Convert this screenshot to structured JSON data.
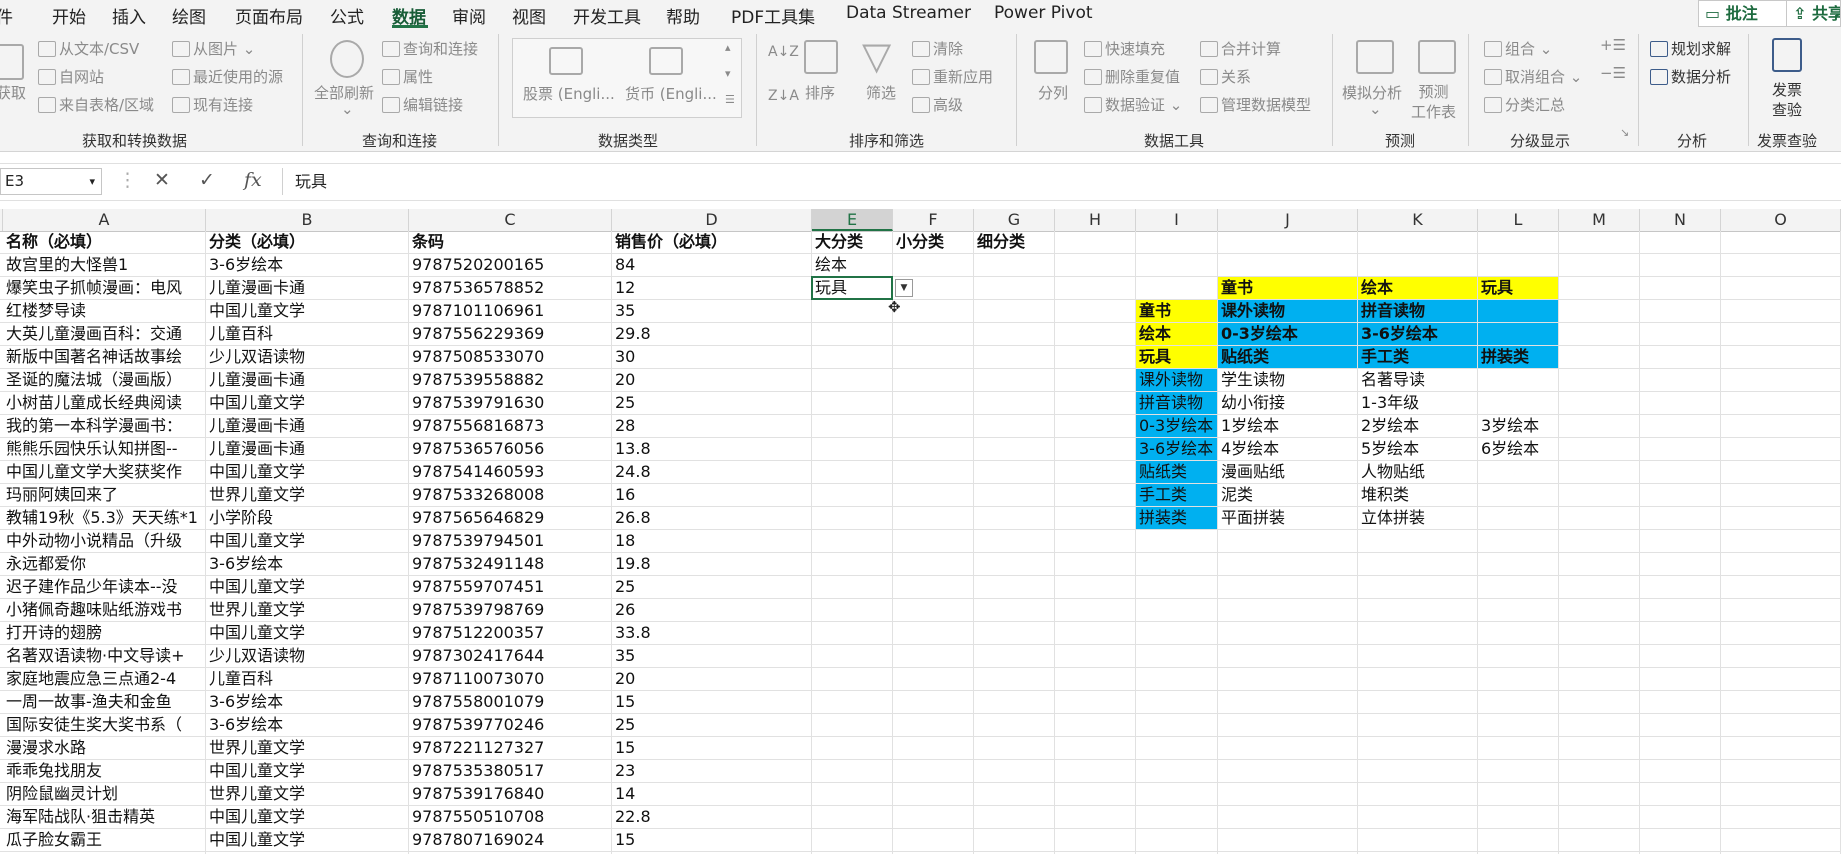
{
  "menu": {
    "tabs": [
      "件",
      "开始",
      "插入",
      "绘图",
      "页面布局",
      "公式",
      "数据",
      "审阅",
      "视图",
      "开发工具",
      "帮助",
      "PDF工具集",
      "Data Streamer",
      "Power Pivot"
    ],
    "active": "数据",
    "comments_btn": "批注",
    "share_btn": "共享"
  },
  "ribbon": {
    "get_data": {
      "label": "获取数据",
      "from_text": "从文本/CSV",
      "from_web": "自网站",
      "from_table": "来自表格/区域",
      "from_picture": "从图片",
      "recent_sources": "最近使用的源",
      "existing_conn": "现有连接",
      "group": "获取和转换数据"
    },
    "queries": {
      "refresh_all": "全部刷新",
      "queries_conn": "查询和连接",
      "properties": "属性",
      "edit_links": "编辑链接",
      "group": "查询和连接"
    },
    "datatypes": {
      "stocks": "股票 (Engli...",
      "currency": "货币 (Engli...",
      "group": "数据类型"
    },
    "sort": {
      "sort": "排序",
      "filter": "筛选",
      "clear": "清除",
      "reapply": "重新应用",
      "advanced": "高级",
      "group": "排序和筛选"
    },
    "tools": {
      "split": "分列",
      "flash_fill": "快速填充",
      "remove_dup": "删除重复值",
      "validation": "数据验证",
      "consolidate": "合并计算",
      "relations": "关系",
      "manage_model": "管理数据模型",
      "group": "数据工具"
    },
    "forecast": {
      "what_if": "模拟分析",
      "sheet": "预测\n工作表",
      "group": "预测"
    },
    "outline": {
      "group_btn": "组合",
      "ungroup": "取消组合",
      "subtotal": "分类汇总",
      "group": "分级显示"
    },
    "analysis": {
      "solver": "规划求解",
      "data_analysis": "数据分析",
      "group": "分析"
    },
    "invoice": {
      "check": "发票\n查验",
      "group": "发票查验"
    }
  },
  "formula_bar": {
    "name_box": "E3",
    "value": "玩具"
  },
  "columns": [
    "A",
    "B",
    "C",
    "D",
    "E",
    "F",
    "G",
    "H",
    "I",
    "J",
    "K",
    "L",
    "M",
    "N",
    "O"
  ],
  "selected_col": "E",
  "header_row": {
    "A": "名称（必填）",
    "B": "分类（必填）",
    "C": "条码",
    "D": "销售价（必填）",
    "E": "大分类",
    "F": "小分类",
    "G": "细分类"
  },
  "rows": [
    [
      "故宫里的大怪兽1",
      "3-6岁绘本",
      "9787520200165",
      "84"
    ],
    [
      "爆笑虫子抓帧漫画：电风",
      "儿童漫画卡通",
      "9787536578852",
      "12"
    ],
    [
      "红楼梦导读",
      "中国儿童文学",
      "9787101106961",
      "35"
    ],
    [
      "大英儿童漫画百科：交通",
      "儿童百科",
      "9787556229369",
      "29.8"
    ],
    [
      "新版中国著名神话故事绘",
      "少儿双语读物",
      "9787508533070",
      "30"
    ],
    [
      "圣诞的魔法城（漫画版）",
      "儿童漫画卡通",
      "9787539558882",
      "20"
    ],
    [
      "小树苗儿童成长经典阅读",
      "中国儿童文学",
      "9787539791630",
      "25"
    ],
    [
      "我的第一本科学漫画书：",
      "儿童漫画卡通",
      "9787556816873",
      "28"
    ],
    [
      "熊熊乐园快乐认知拼图--",
      "儿童漫画卡通",
      "9787536576056",
      "13.8"
    ],
    [
      "中国儿童文学大奖获奖作",
      "中国儿童文学",
      "9787541460593",
      "24.8"
    ],
    [
      "玛丽阿姨回来了",
      "世界儿童文学",
      "9787533268008",
      "16"
    ],
    [
      "教辅19秋《5.3》天天练*1",
      "小学阶段",
      "9787565646829",
      "26.8"
    ],
    [
      "中外动物小说精品（升级",
      "中国儿童文学",
      "9787539794501",
      "18"
    ],
    [
      "永远都爱你",
      "3-6岁绘本",
      "9787532491148",
      "19.8"
    ],
    [
      "迟子建作品少年读本--没",
      "中国儿童文学",
      "9787559707451",
      "25"
    ],
    [
      "小猪佩奇趣味贴纸游戏书",
      "世界儿童文学",
      "9787539798769",
      "26"
    ],
    [
      "打开诗的翅膀",
      "中国儿童文学",
      "9787512200357",
      "33.8"
    ],
    [
      "名著双语读物·中文导读+",
      "少儿双语读物",
      "9787302417644",
      "35"
    ],
    [
      "家庭地震应急三点通2-4",
      "儿童百科",
      "9787110073070",
      "20"
    ],
    [
      "一周一故事-渔夫和金鱼",
      "3-6岁绘本",
      "9787558001079",
      "15"
    ],
    [
      "国际安徒生奖大奖书系（",
      "3-6岁绘本",
      "9787539770246",
      "25"
    ],
    [
      "漫漫求水路",
      "世界儿童文学",
      "9787221127327",
      "15"
    ],
    [
      "乖乖兔找朋友",
      "中国儿童文学",
      "9787535380517",
      "23"
    ],
    [
      "阴险鼠幽灵计划",
      "世界儿童文学",
      "9787539176840",
      "14"
    ],
    [
      "海军陆战队·狙击精英",
      "中国儿童文学",
      "9787550510708",
      "22.8"
    ],
    [
      "瓜子脸女霸王",
      "中国儿童文学",
      "9787807169024",
      "15"
    ]
  ],
  "e_values": {
    "row2": "绘本",
    "row3": "玩具"
  },
  "lookup": {
    "header": [
      "童书",
      "绘本",
      "玩具"
    ],
    "side": [
      {
        "label": "童书",
        "vals": [
          "课外读物",
          "拼音读物",
          ""
        ]
      },
      {
        "label": "绘本",
        "vals": [
          "0-3岁绘本",
          "3-6岁绘本",
          ""
        ]
      },
      {
        "label": "玩具",
        "vals": [
          "贴纸类",
          "手工类",
          "拼装类"
        ]
      }
    ],
    "sub": [
      {
        "label": "课外读物",
        "vals": [
          "学生读物",
          "名著导读",
          ""
        ]
      },
      {
        "label": "拼音读物",
        "vals": [
          "幼小衔接",
          "1-3年级",
          ""
        ]
      },
      {
        "label": "0-3岁绘本",
        "vals": [
          "1岁绘本",
          "2岁绘本",
          "3岁绘本"
        ]
      },
      {
        "label": "3-6岁绘本",
        "vals": [
          "4岁绘本",
          "5岁绘本",
          "6岁绘本"
        ]
      },
      {
        "label": "贴纸类",
        "vals": [
          "漫画贴纸",
          "人物贴纸",
          ""
        ]
      },
      {
        "label": "手工类",
        "vals": [
          "泥类",
          "堆积类",
          ""
        ]
      },
      {
        "label": "拼装类",
        "vals": [
          "平面拼装",
          "立体拼装",
          ""
        ]
      }
    ]
  },
  "colors": {
    "yellow": "#ffff00",
    "blue": "#00b0f0",
    "accent": "#217346"
  }
}
